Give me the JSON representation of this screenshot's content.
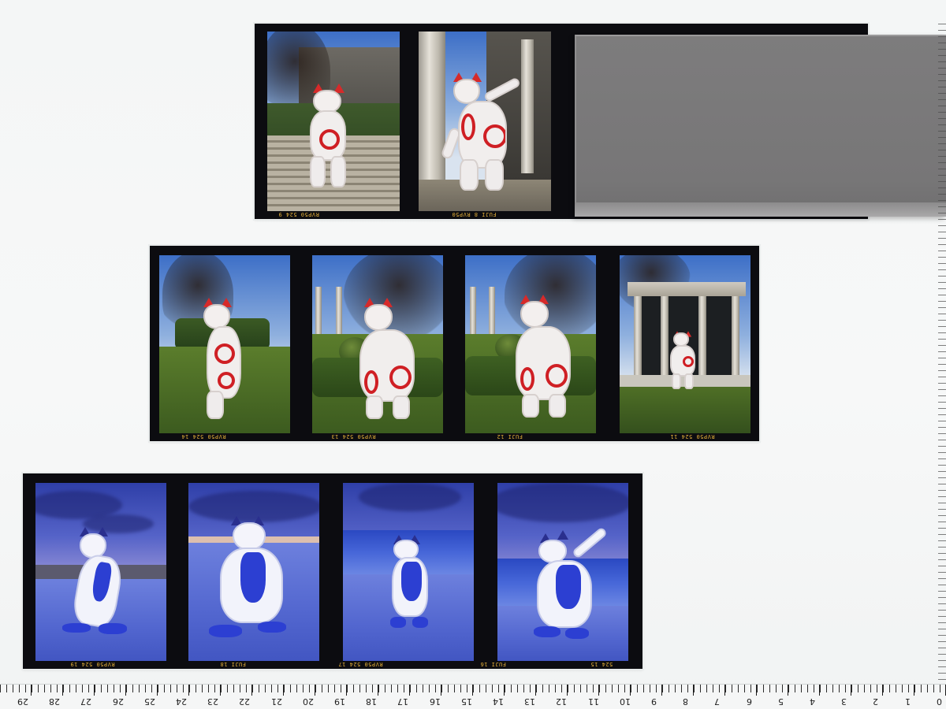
{
  "strips": [
    {
      "id": "top",
      "frame_numbers": [
        "9",
        "8"
      ],
      "edge_labels": [
        "RVP50",
        "524",
        "FUJI",
        "RVP50"
      ],
      "scenes": [
        "garden-stairs",
        "columns-courtyard"
      ]
    },
    {
      "id": "middle",
      "frame_numbers": [
        "14",
        "13",
        "12",
        "11"
      ],
      "edge_labels": [
        "RVP50",
        "524",
        "FUJI",
        "RVP50"
      ],
      "scenes": [
        "garden-lawn",
        "hedge-garden",
        "hedge-garden",
        "pavilion"
      ]
    },
    {
      "id": "bottom",
      "frame_numbers": [
        "19",
        "18",
        "17",
        "16",
        "15"
      ],
      "edge_labels": [
        "RVP50",
        "524",
        "FUJI",
        "RVP50"
      ],
      "scenes": [
        "beach-dusk",
        "beach-dusk",
        "beach-dusk",
        "beach-dusk"
      ]
    }
  ],
  "ruler": {
    "numbers": [
      "29",
      "28",
      "27",
      "26",
      "25",
      "24",
      "23",
      "22",
      "21",
      "20",
      "19",
      "18",
      "17",
      "16",
      "15",
      "14",
      "13",
      "12",
      "11",
      "10",
      "9",
      "8",
      "7",
      "6",
      "5",
      "4",
      "3",
      "2",
      "1",
      "0"
    ]
  },
  "colors": {
    "film_base": "#0c0c10",
    "edge_text": "#e6b13a",
    "costume_red": "#cf1f24",
    "costume_blue": "#2c3fd2",
    "cover_grey": "#7a797a"
  },
  "labels": {
    "f_top_1": "RVP50  524  9",
    "f_top_2": "FUJI 8  RVP50",
    "f_mid_1": "RVP50  524  14",
    "f_mid_2": "RVP50  524  13",
    "f_mid_3": "FUJI 12",
    "f_mid_4": "RVP50  524  11",
    "f_bot_1": "RVP50  524  19",
    "f_bot_2": "FUJI 18",
    "f_bot_3": "RVP50  524  17",
    "f_bot_4": "FUJI 16",
    "f_bot_5": "524  15"
  }
}
